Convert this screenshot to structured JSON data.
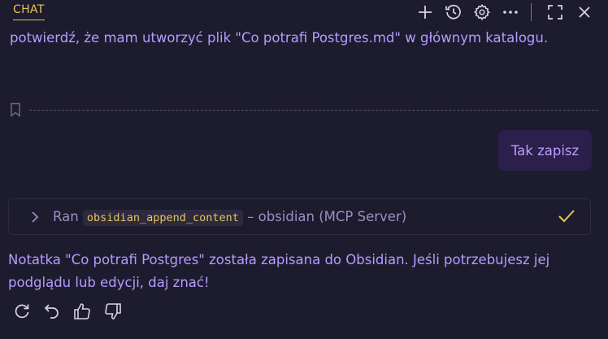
{
  "header": {
    "tab_label": "CHAT",
    "icons": [
      "plus-icon",
      "history-icon",
      "gear-icon",
      "more-icon",
      "maximize-icon",
      "close-icon"
    ]
  },
  "messages": {
    "assistant_prompt": "potwierdź, że mam utworzyć plik \"Co potrafi Postgres.md\" w głównym katalogu.",
    "user_reply": "Tak zapisz",
    "tool_call": {
      "prefix": "Ran",
      "tool_name": "obsidian_append_content",
      "suffix": "– obsidian (MCP Server)"
    },
    "assistant_answer": "Notatka \"Co potrafi Postgres\" została zapisana do Obsidian. Jeśli potrzebujesz jej podglądu lub edycji, daj znać!"
  },
  "colors": {
    "background": "#1d1b2e",
    "accent": "#e6c35a",
    "text": "#b69cff",
    "user_bubble": "#2b1f4b"
  },
  "actions": [
    "retry-icon",
    "undo-icon",
    "thumbs-up-icon",
    "thumbs-down-icon"
  ]
}
